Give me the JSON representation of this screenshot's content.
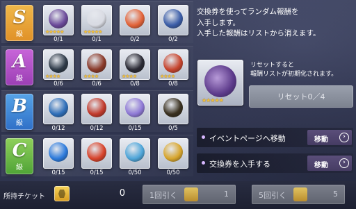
{
  "tiers": [
    {
      "letter": "S",
      "kyu": "級",
      "color": "#e9a637",
      "items": [
        {
          "icon": "purple-creature-icon",
          "count": "0/1",
          "stars": "★★★★★",
          "art": "#6b4a9a"
        },
        {
          "icon": "white-armor-icon",
          "count": "0/1",
          "stars": "★★★★★",
          "art": "#d9dbe3"
        },
        {
          "icon": "orange-orb-icon",
          "count": "0/2",
          "stars": "",
          "art": "#e3643a"
        },
        {
          "icon": "blue-crystal-gear-icon",
          "count": "0/2",
          "stars": "",
          "art": "#3c5ea8"
        }
      ]
    },
    {
      "letter": "A",
      "kyu": "級",
      "color": "#b352cc",
      "items": [
        {
          "icon": "dark-container-icon",
          "count": "0/6",
          "stars": "★★★★",
          "art": "#2e3a48"
        },
        {
          "icon": "red-blade-icon",
          "count": "0/6",
          "stars": "★★★★",
          "art": "#8a3a2a"
        },
        {
          "icon": "black-device-icon",
          "count": "0/8",
          "stars": "★★★★",
          "art": "#2a2a34"
        },
        {
          "icon": "red-scroll-icon",
          "count": "0/8",
          "stars": "★★★★",
          "art": "#c7452e"
        }
      ]
    },
    {
      "letter": "B",
      "kyu": "級",
      "color": "#3e86d6",
      "items": [
        {
          "icon": "blue-gem-icon",
          "count": "0/12",
          "stars": "",
          "art": "#2f6fb9"
        },
        {
          "icon": "red-gem-icon",
          "count": "0/12",
          "stars": "",
          "art": "#c23b2d"
        },
        {
          "icon": "rainbow-crystal-icon",
          "count": "0/15",
          "stars": "",
          "art": "#8f7ad6"
        },
        {
          "icon": "gold-card-icon",
          "count": "0/5",
          "stars": "",
          "art": "#3a3120"
        }
      ]
    },
    {
      "letter": "C",
      "kyu": "級",
      "color": "#6dbb46",
      "items": [
        {
          "icon": "blue-orb-icon",
          "count": "0/15",
          "stars": "",
          "art": "#2d7bdc"
        },
        {
          "icon": "red-orb-icon",
          "count": "0/15",
          "stars": "",
          "art": "#d8442c"
        },
        {
          "icon": "blue-drop-icon",
          "count": "0/50",
          "stars": "",
          "art": "#4fa6d9"
        },
        {
          "icon": "gold-coin-icon",
          "count": "0/50",
          "stars": "",
          "art": "#d8a62d"
        }
      ]
    }
  ],
  "description": {
    "line1": "交換券を使ってランダム報酬を",
    "line2": "入手します。",
    "line3": "入手した報酬はリストから消えます。"
  },
  "reset": {
    "note_line1": "リセットすると",
    "note_line2": "報酬リストが初期化されます。",
    "button_label": "リセット0／4"
  },
  "actions": [
    {
      "label": "イベントページへ移動",
      "button": "移動"
    },
    {
      "label": "交換券を入手する",
      "button": "移動"
    }
  ],
  "bottom": {
    "ticket_label": "所持チケット",
    "ticket_count": "0",
    "draw1_label": "1回引く",
    "draw1_cost": "1",
    "draw5_label": "5回引く",
    "draw5_cost": "5"
  }
}
